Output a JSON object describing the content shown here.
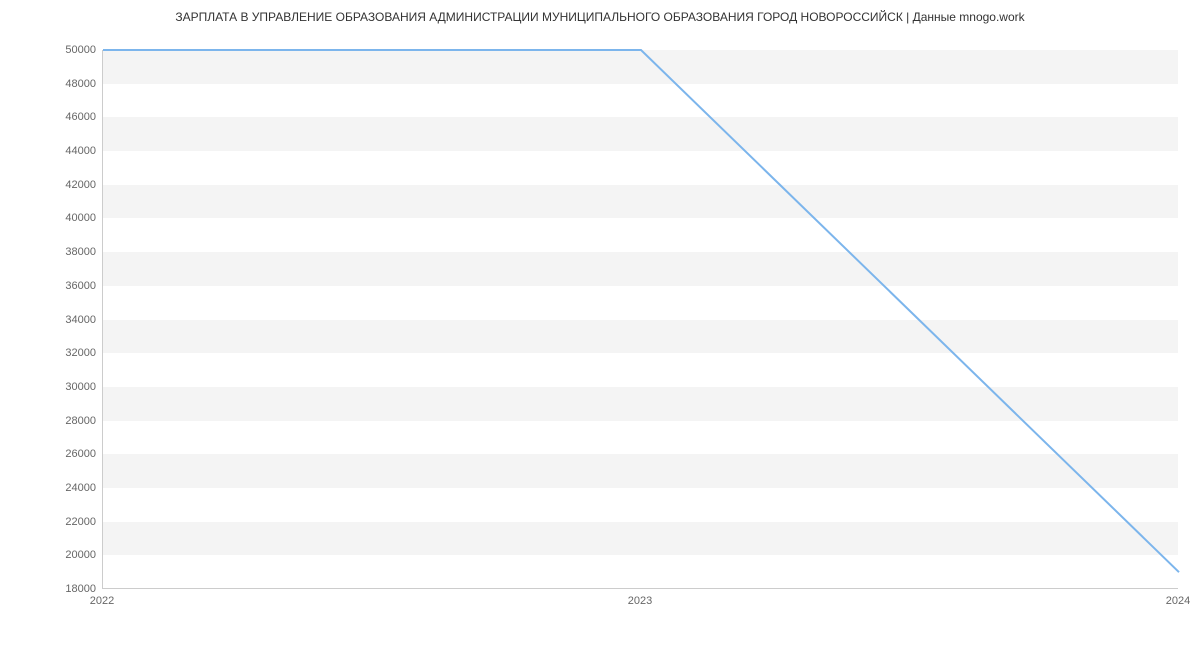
{
  "chart_data": {
    "type": "line",
    "title": "ЗАРПЛАТА В УПРАВЛЕНИЕ ОБРАЗОВАНИЯ АДМИНИСТРАЦИИ МУНИЦИПАЛЬНОГО ОБРАЗОВАНИЯ ГОРОД НОВОРОССИЙСК | Данные mnogo.work",
    "x": [
      2022,
      2023,
      2024
    ],
    "values": [
      50000,
      50000,
      19000
    ],
    "xlabel": "",
    "ylabel": "",
    "ylim": [
      18000,
      50000
    ],
    "y_ticks": [
      18000,
      20000,
      22000,
      24000,
      26000,
      28000,
      30000,
      32000,
      34000,
      36000,
      38000,
      40000,
      42000,
      44000,
      46000,
      48000,
      50000
    ],
    "x_ticks": [
      "2022",
      "2023",
      "2024"
    ],
    "line_color": "#7cb5ec"
  }
}
